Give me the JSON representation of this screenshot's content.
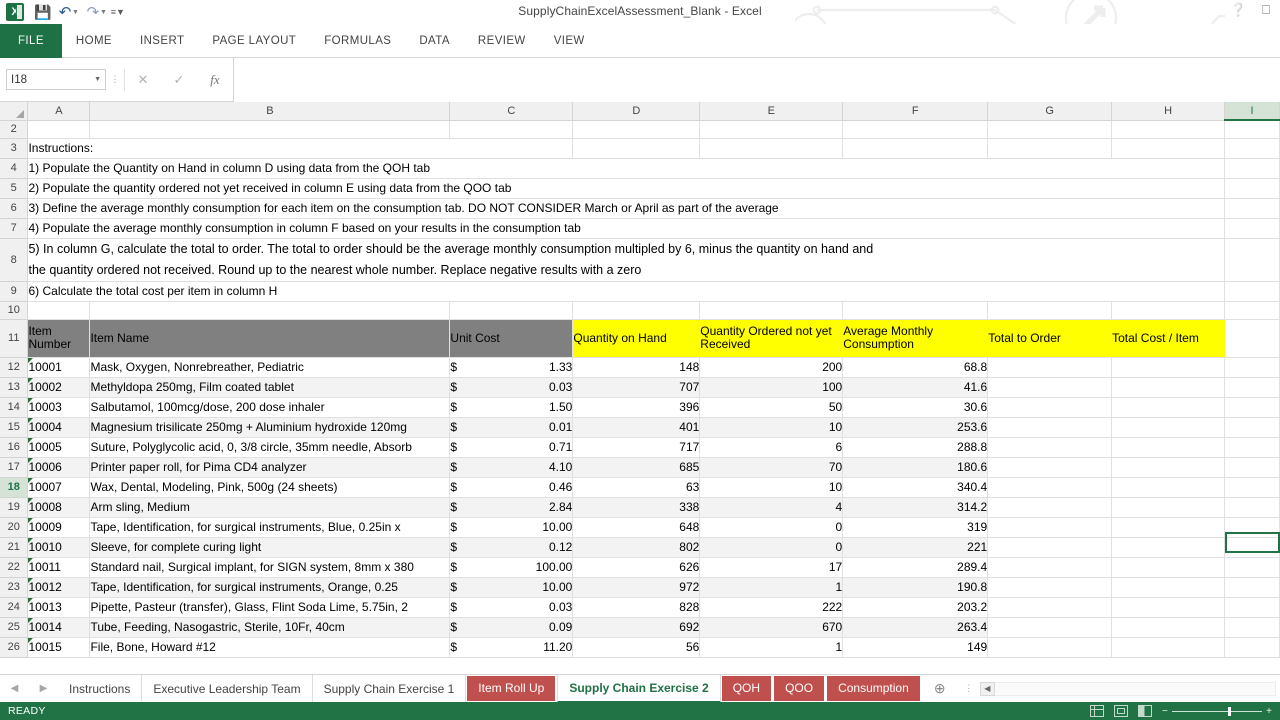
{
  "window": {
    "title": "SupplyChainExcelAssessment_Blank - Excel",
    "help_icon": "help-question-icon",
    "ribbon_options_icon": "ribbon-display-options-icon"
  },
  "quick_access": {
    "logo_text": "X",
    "save_icon": "save-icon",
    "undo_icon": "undo-arrow-icon",
    "redo_icon": "redo-arrow-icon",
    "customize_icon": "customize-qat-icon"
  },
  "ribbon": {
    "tabs": [
      {
        "label": "FILE"
      },
      {
        "label": "HOME"
      },
      {
        "label": "INSERT"
      },
      {
        "label": "PAGE LAYOUT"
      },
      {
        "label": "FORMULAS"
      },
      {
        "label": "DATA"
      },
      {
        "label": "REVIEW"
      },
      {
        "label": "VIEW"
      }
    ]
  },
  "formula_bar": {
    "name_box_value": "I18",
    "cancel_icon": "cancel-x-icon",
    "enter_icon": "enter-check-icon",
    "function_icon": "insert-function-fx-icon",
    "formula_value": "",
    "formula_placeholder": ""
  },
  "grid": {
    "columns": [
      "A",
      "B",
      "C",
      "D",
      "E",
      "F",
      "G",
      "H",
      "I"
    ],
    "active_column": "I",
    "active_row": "18",
    "rows_visible": [
      "2",
      "3",
      "4",
      "5",
      "6",
      "7",
      "8",
      "9",
      "10",
      "11",
      "12",
      "13",
      "14",
      "15",
      "16",
      "17",
      "18",
      "19",
      "20",
      "21",
      "22",
      "23",
      "24",
      "25",
      "26"
    ],
    "instructions": {
      "heading": "Instructions:",
      "lines": [
        "1) Populate the Quantity on Hand in column D using data from the QOH tab",
        "2) Populate the quantity ordered not yet received in column E using data from the QOO tab",
        "3) Define the average monthly consumption for each item on the consumption tab. DO NOT CONSIDER March or April as part of the average",
        "4) Populate the average monthly consumption in column F based on your results in the consumption tab",
        "5) In column G, calculate the total to order. The total to order should be the average monthly consumption multipled by 6, minus the quantity on hand and",
        "the quantity ordered not received. Round up to the nearest whole number. Replace negative results with a zero",
        "6) Calculate the total cost per item in column H"
      ]
    },
    "table_headers": {
      "item_number": "Item Number",
      "item_name": "Item Name",
      "unit_cost": "Unit Cost",
      "quantity_on_hand": "Quantity on Hand",
      "quantity_ordered_not_yet_received": "Quantity Ordered not yet Received",
      "average_monthly_consumption": "Average Monthly Consumption",
      "total_to_order": "Total to Order",
      "total_cost_per_item": "Total Cost / Item"
    },
    "table_rows": [
      {
        "row": "12",
        "item_number": "10001",
        "item_name": "Mask, Oxygen, Nonrebreather, Pediatric",
        "currency": "$",
        "unit_cost": "1.33",
        "qoh": "148",
        "qoo": "200",
        "amc": "68.8",
        "total_to_order": "",
        "total_cost": ""
      },
      {
        "row": "13",
        "item_number": "10002",
        "item_name": "Methyldopa 250mg, Film coated tablet",
        "currency": "$",
        "unit_cost": "0.03",
        "qoh": "707",
        "qoo": "100",
        "amc": "41.6",
        "total_to_order": "",
        "total_cost": ""
      },
      {
        "row": "14",
        "item_number": "10003",
        "item_name": "Salbutamol, 100mcg/dose, 200 dose inhaler",
        "currency": "$",
        "unit_cost": "1.50",
        "qoh": "396",
        "qoo": "50",
        "amc": "30.6",
        "total_to_order": "",
        "total_cost": ""
      },
      {
        "row": "15",
        "item_number": "10004",
        "item_name": "Magnesium trisilicate 250mg + Aluminium hydroxide 120mg",
        "currency": "$",
        "unit_cost": "0.01",
        "qoh": "401",
        "qoo": "10",
        "amc": "253.6",
        "total_to_order": "",
        "total_cost": ""
      },
      {
        "row": "16",
        "item_number": "10005",
        "item_name": "Suture, Polyglycolic acid, 0, 3/8 circle, 35mm needle, Absorb",
        "currency": "$",
        "unit_cost": "0.71",
        "qoh": "717",
        "qoo": "6",
        "amc": "288.8",
        "total_to_order": "",
        "total_cost": ""
      },
      {
        "row": "17",
        "item_number": "10006",
        "item_name": "Printer paper roll, for Pima CD4 analyzer",
        "currency": "$",
        "unit_cost": "4.10",
        "qoh": "685",
        "qoo": "70",
        "amc": "180.6",
        "total_to_order": "",
        "total_cost": ""
      },
      {
        "row": "18",
        "item_number": "10007",
        "item_name": "Wax, Dental, Modeling, Pink, 500g (24 sheets)",
        "currency": "$",
        "unit_cost": "0.46",
        "qoh": "63",
        "qoo": "10",
        "amc": "340.4",
        "total_to_order": "",
        "total_cost": ""
      },
      {
        "row": "19",
        "item_number": "10008",
        "item_name": "Arm sling, Medium",
        "currency": "$",
        "unit_cost": "2.84",
        "qoh": "338",
        "qoo": "4",
        "amc": "314.2",
        "total_to_order": "",
        "total_cost": ""
      },
      {
        "row": "20",
        "item_number": "10009",
        "item_name": "Tape, Identification, for surgical instruments, Blue, 0.25in x",
        "currency": "$",
        "unit_cost": "10.00",
        "qoh": "648",
        "qoo": "0",
        "amc": "319",
        "total_to_order": "",
        "total_cost": ""
      },
      {
        "row": "21",
        "item_number": "10010",
        "item_name": "Sleeve, for complete curing light",
        "currency": "$",
        "unit_cost": "0.12",
        "qoh": "802",
        "qoo": "0",
        "amc": "221",
        "total_to_order": "",
        "total_cost": ""
      },
      {
        "row": "22",
        "item_number": "10011",
        "item_name": "Standard nail, Surgical implant, for SIGN system, 8mm x 380",
        "currency": "$",
        "unit_cost": "100.00",
        "qoh": "626",
        "qoo": "17",
        "amc": "289.4",
        "total_to_order": "",
        "total_cost": ""
      },
      {
        "row": "23",
        "item_number": "10012",
        "item_name": "Tape, Identification, for surgical instruments, Orange, 0.25",
        "currency": "$",
        "unit_cost": "10.00",
        "qoh": "972",
        "qoo": "1",
        "amc": "190.8",
        "total_to_order": "",
        "total_cost": ""
      },
      {
        "row": "24",
        "item_number": "10013",
        "item_name": "Pipette, Pasteur (transfer), Glass, Flint Soda Lime, 5.75in, 2",
        "currency": "$",
        "unit_cost": "0.03",
        "qoh": "828",
        "qoo": "222",
        "amc": "203.2",
        "total_to_order": "",
        "total_cost": ""
      },
      {
        "row": "25",
        "item_number": "10014",
        "item_name": "Tube, Feeding, Nasogastric, Sterile, 10Fr, 40cm",
        "currency": "$",
        "unit_cost": "0.09",
        "qoh": "692",
        "qoo": "670",
        "amc": "263.4",
        "total_to_order": "",
        "total_cost": ""
      },
      {
        "row": "26",
        "item_number": "10015",
        "item_name": "File, Bone, Howard #12",
        "currency": "$",
        "unit_cost": "11.20",
        "qoh": "56",
        "qoo": "1",
        "amc": "149",
        "total_to_order": "",
        "total_cost": ""
      }
    ]
  },
  "sheet_tabs": {
    "prev_icon": "previous-sheet-icon",
    "next_icon": "next-sheet-icon",
    "add_icon": "add-sheet-plus-icon",
    "tabs": [
      {
        "label": "Instructions",
        "style": "plain"
      },
      {
        "label": "Executive Leadership Team",
        "style": "plain"
      },
      {
        "label": "Supply Chain Exercise 1",
        "style": "plain"
      },
      {
        "label": "Item Roll Up",
        "style": "red"
      },
      {
        "label": "Supply Chain Exercise 2",
        "style": "active"
      },
      {
        "label": "QOH",
        "style": "red"
      },
      {
        "label": "QOO",
        "style": "red"
      },
      {
        "label": "Consumption",
        "style": "red"
      }
    ]
  },
  "status_bar": {
    "mode": "READY",
    "view_normal_icon": "normal-view-icon",
    "view_page_layout_icon": "page-layout-view-icon",
    "view_page_break_icon": "page-break-preview-icon",
    "zoom_out_icon": "zoom-out-icon",
    "zoom_in_icon": "zoom-in-icon"
  },
  "colors": {
    "accent_green": "#217346",
    "file_tab_green": "#1e7145",
    "header_gray": "#808080",
    "header_yellow": "#ffff00",
    "tab_red": "#c0504d"
  }
}
